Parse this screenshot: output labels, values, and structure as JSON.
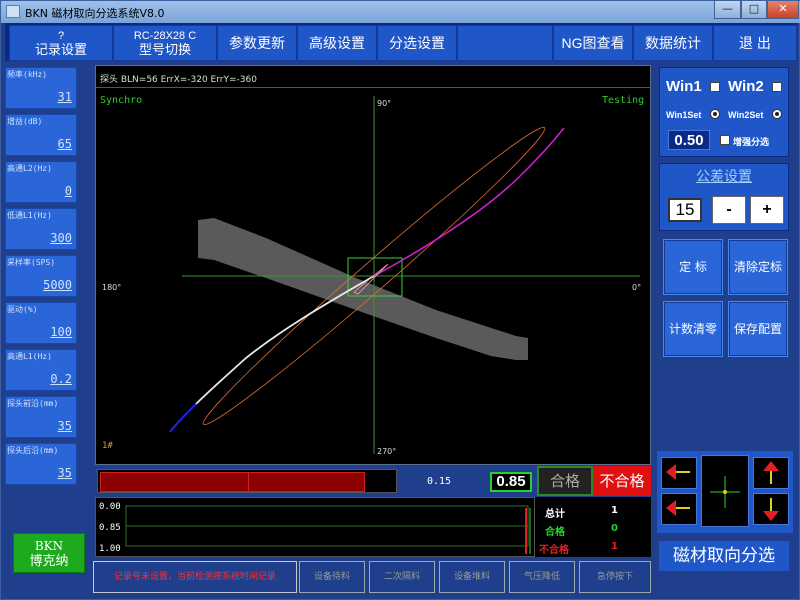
{
  "window": {
    "title": "BKN 磁材取向分选系统V8.0",
    "btn_min": "—",
    "btn_max": "□",
    "btn_close": "✕"
  },
  "toolbar": {
    "record_settings_top": "?",
    "record_settings": "记录设置",
    "model_switch_top": "RC-28X28 C",
    "model_switch": "型号切换",
    "param_update": "参数更新",
    "advanced_settings": "高级设置",
    "sort_settings": "分选设置",
    "ng_view": "NG图查看",
    "data_stats": "数据统计",
    "exit": "退  出"
  },
  "left_params": [
    {
      "label": "频率(kHz)",
      "value": "31"
    },
    {
      "label": "增益(dB)",
      "value": "65"
    },
    {
      "label": "高通L2(Hz)",
      "value": "0"
    },
    {
      "label": "低通L1(Hz)",
      "value": "300"
    },
    {
      "label": "采样率(SPS)",
      "value": "5000"
    },
    {
      "label": "驱动(%)",
      "value": "100"
    },
    {
      "label": "高通L1(Hz)",
      "value": "0.2"
    },
    {
      "label": "探头前沿(mm)",
      "value": "35"
    },
    {
      "label": "探头后沿(mm)",
      "value": "35"
    }
  ],
  "brand": {
    "line1": "BKN",
    "line2": "博克纳"
  },
  "scope": {
    "header": "探头 BLN=56  ErrX=-320  ErrY=-360",
    "mode_left": "Synchro",
    "mode_right": "Testing",
    "label_top": "90°",
    "label_bottom": "270°",
    "label_left": "180°",
    "label_right": "0°",
    "channel": "1#"
  },
  "win_controls": {
    "win1": "Win1",
    "win2": "Win2",
    "win1set": "Win1Set",
    "win2set": "Win2Set",
    "value": "0.50",
    "enhance": "增强分选"
  },
  "tolerance": {
    "title": "公差设置",
    "value": "15",
    "minus": "-",
    "plus": "+"
  },
  "actions": {
    "calibrate": "定  标",
    "clear_calibration": "清除定标",
    "clear_count": "计数清零",
    "save_config": "保存配置"
  },
  "app_name": "磁材取向分选",
  "result": {
    "progress_fraction": 0.9,
    "threshold_value": "0.15",
    "current_value": "0.85",
    "pass_label": "合格",
    "fail_label": "不合格"
  },
  "trend": {
    "y_labels": [
      "0.00",
      "0.85",
      "1.00"
    ]
  },
  "stats": {
    "total_label": "总计",
    "total_value": "1",
    "pass_label": "合格",
    "pass_value": "0",
    "fail_label": "不合格",
    "fail_value": "1"
  },
  "statusbar": {
    "message": "记录号未设置，当前检测按系统时间记录",
    "equip_wait": "设备待料",
    "second_pass": "二次隔料",
    "equip_stack": "设备堆料",
    "air_low": "气压降低",
    "emergency": "急停按下"
  },
  "colors": {
    "window_bg": "#1f3f8c",
    "button_blue": "#1f56c8",
    "pass_green": "#2ad02a",
    "fail_red": "#e01010"
  }
}
